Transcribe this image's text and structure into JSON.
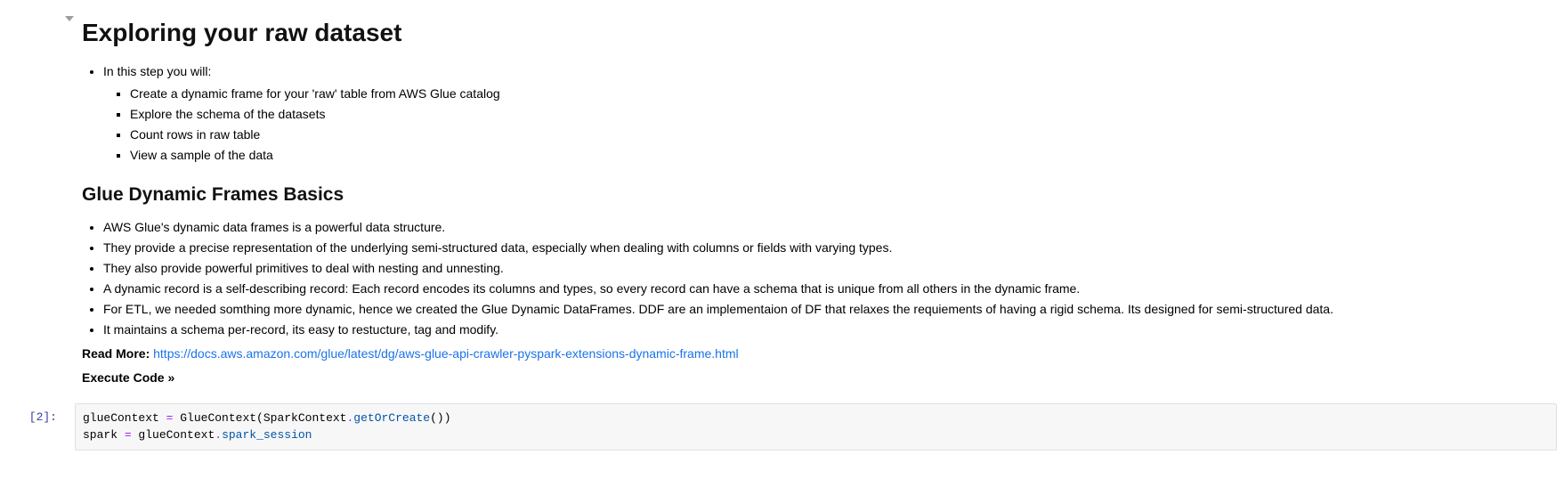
{
  "md": {
    "h1": "Exploring your raw dataset",
    "intro": "In this step you will:",
    "intro_items": {
      "i0": "Create a dynamic frame for your 'raw' table from AWS Glue catalog",
      "i1": "Explore the schema of the datasets",
      "i2": "Count rows in raw table",
      "i3": "View a sample of the data"
    },
    "h2": "Glue Dynamic Frames Basics",
    "bullets": {
      "b0": "AWS Glue's dynamic data frames is a powerful data structure.",
      "b1": "They provide a precise representation of the underlying semi-structured data, especially when dealing with columns or fields with varying types.",
      "b2": "They also provide powerful primitives to deal with nesting and unnesting.",
      "b3": "A dynamic record is a self-describing record: Each record encodes its columns and types, so every record can have a schema that is unique from all others in the dynamic frame.",
      "b4": "For ETL, we needed somthing more dynamic, hence we created the Glue Dynamic DataFrames. DDF are an implementaion of DF that relaxes the requiements of having a rigid schema. Its designed for semi-structured data.",
      "b5": "It maintains a schema per-record, its easy to restucture, tag and modify."
    },
    "readmore_label": "Read More: ",
    "readmore_link": "https://docs.aws.amazon.com/glue/latest/dg/aws-glue-api-crawler-pyspark-extensions-dynamic-frame.html",
    "execute": "Execute Code »"
  },
  "code_cell": {
    "prompt": "[2]:",
    "line1_parts": {
      "p0": "glueContext ",
      "p1": "=",
      "p2": " GlueContext(SparkContext",
      "p3": ".",
      "p4": "getOrCreate",
      "p5": "())"
    },
    "line2_parts": {
      "p0": "spark ",
      "p1": "=",
      "p2": " glueContext",
      "p3": ".",
      "p4": "spark_session"
    }
  }
}
